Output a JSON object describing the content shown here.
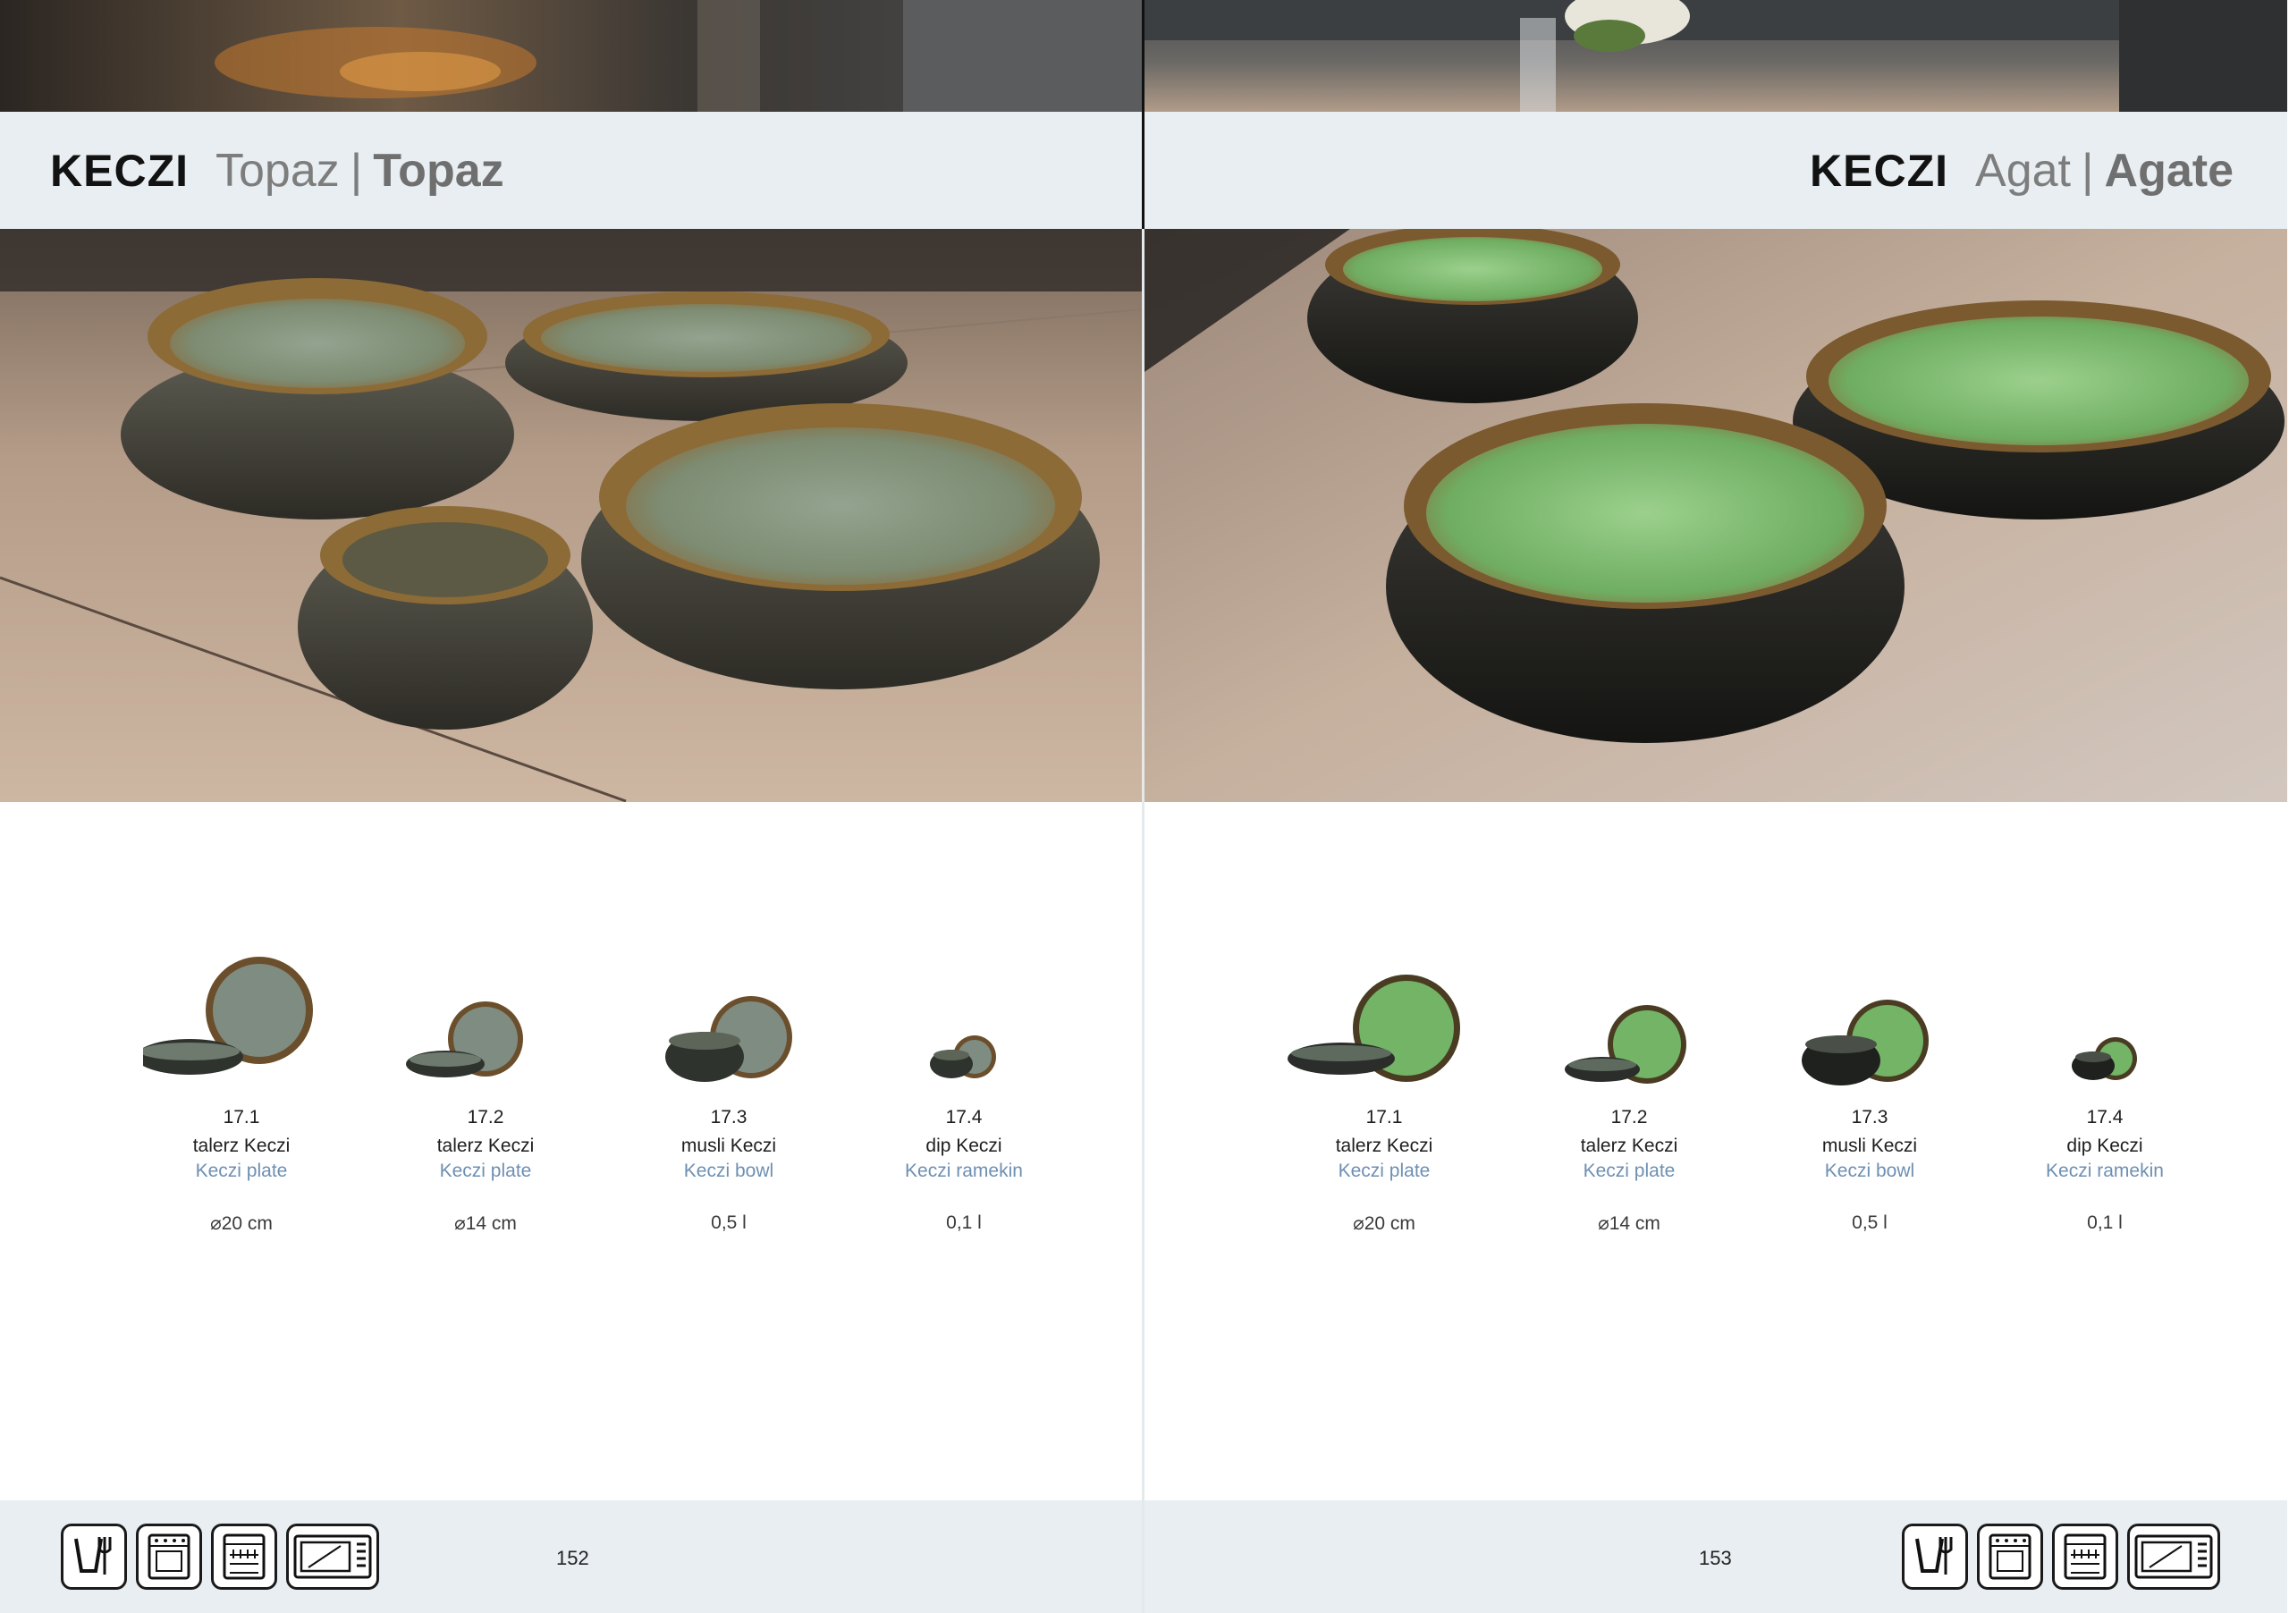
{
  "left_page": {
    "title": {
      "brand": "KECZI",
      "name_pl": "Topaz",
      "separator": "|",
      "name_en": "Topaz"
    },
    "products": [
      {
        "code": "17.1",
        "name_pl": "talerz Keczi",
        "name_en": "Keczi plate",
        "size": "⌀20 cm"
      },
      {
        "code": "17.2",
        "name_pl": "talerz Keczi",
        "name_en": "Keczi plate",
        "size": "⌀14 cm"
      },
      {
        "code": "17.3",
        "name_pl": "musli Keczi",
        "name_en": "Keczi bowl",
        "size": "0,5 l"
      },
      {
        "code": "17.4",
        "name_pl": "dip Keczi",
        "name_en": "Keczi ramekin",
        "size": "0,1 l"
      }
    ],
    "page_number": "152",
    "icons": [
      "food-safe-icon",
      "oven-icon",
      "dishwasher-icon",
      "microwave-icon"
    ]
  },
  "right_page": {
    "title": {
      "brand": "KECZI",
      "name_pl": "Agat",
      "separator": "|",
      "name_en": "Agate"
    },
    "products": [
      {
        "code": "17.1",
        "name_pl": "talerz Keczi",
        "name_en": "Keczi plate",
        "size": "⌀20 cm"
      },
      {
        "code": "17.2",
        "name_pl": "talerz Keczi",
        "name_en": "Keczi plate",
        "size": "⌀14 cm"
      },
      {
        "code": "17.3",
        "name_pl": "musli Keczi",
        "name_en": "Keczi bowl",
        "size": "0,5 l"
      },
      {
        "code": "17.4",
        "name_pl": "dip Keczi",
        "name_en": "Keczi ramekin",
        "size": "0,1 l"
      }
    ],
    "page_number": "153",
    "icons": [
      "food-safe-icon",
      "oven-icon",
      "dishwasher-icon",
      "microwave-icon"
    ]
  },
  "colors": {
    "band": "#e8eef1",
    "english_text": "#6e8fb3",
    "topaz_glaze": "#8a9a80",
    "agate_glaze": "#79b86e"
  }
}
